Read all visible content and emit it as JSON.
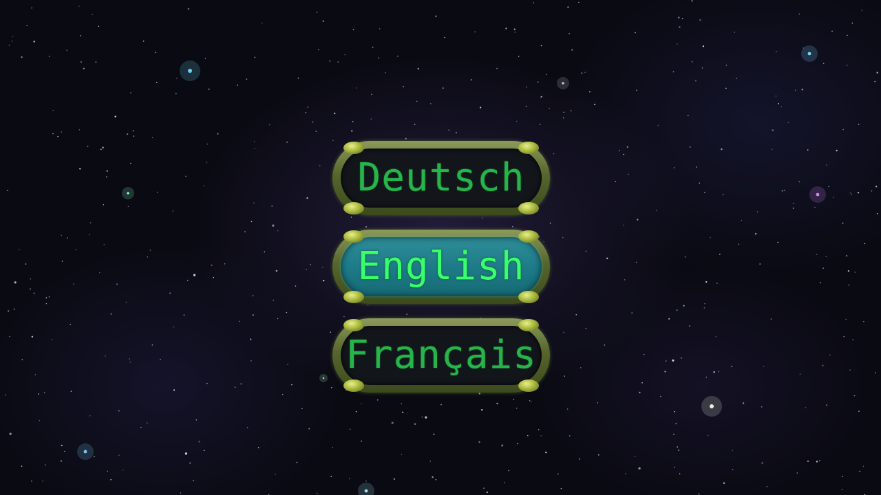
{
  "language_menu": {
    "options": [
      {
        "label": "Deutsch",
        "selected": false
      },
      {
        "label": "English",
        "selected": true
      },
      {
        "label": "Français",
        "selected": false
      }
    ]
  },
  "colors": {
    "label_text": "#26b54a",
    "selected_label_text": "#39ff6c",
    "selected_fill": "#1c7a86",
    "frame": "#56662c",
    "background": "#0a0a12"
  }
}
